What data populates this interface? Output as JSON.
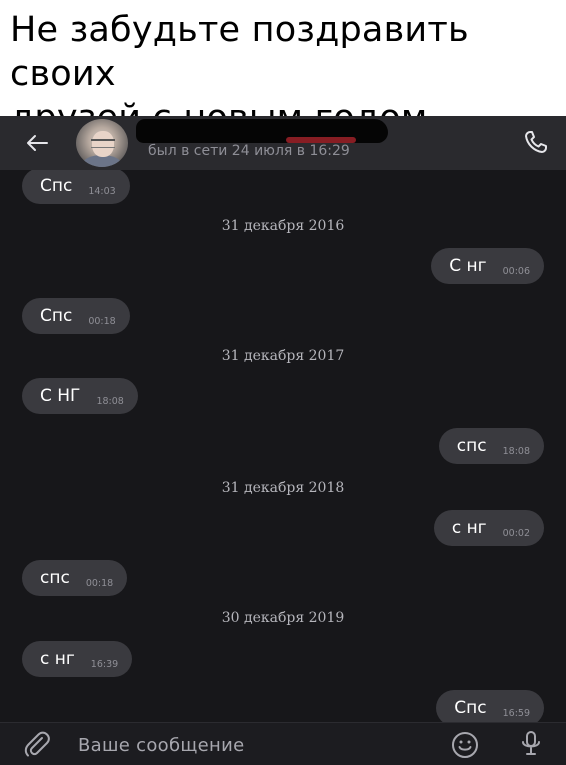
{
  "caption": {
    "line1": "Не забудьте поздравить своих",
    "line2": "друзей с новым годом"
  },
  "header": {
    "last_seen": "был в сети 24 июля в 16:29",
    "back_icon": "arrow-left-icon",
    "call_icon": "phone-icon"
  },
  "messages": [
    {
      "side": "in",
      "text": "Спс",
      "time": "14:03"
    },
    {
      "date": "31 декабря 2016"
    },
    {
      "side": "out",
      "text": "С нг",
      "time": "00:06"
    },
    {
      "side": "in",
      "text": "Спс",
      "time": "00:18"
    },
    {
      "date": "31 декабря 2017"
    },
    {
      "side": "in",
      "text": "С НГ",
      "time": "18:08"
    },
    {
      "side": "out",
      "text": "спс",
      "time": "18:08"
    },
    {
      "date": "31 декабря 2018"
    },
    {
      "side": "out",
      "text": "с нг",
      "time": "00:02"
    },
    {
      "side": "in",
      "text": "спс",
      "time": "00:18"
    },
    {
      "date": "30 декабря 2019"
    },
    {
      "side": "in",
      "text": "с нг",
      "time": "16:39"
    },
    {
      "side": "out",
      "text": "Спс",
      "time": "16:59"
    }
  ],
  "composer": {
    "placeholder": "Ваше сообщение",
    "attach_icon": "paperclip-icon",
    "emoji_icon": "smiley-icon",
    "mic_icon": "microphone-icon"
  },
  "colors": {
    "chat_bg": "#17171a",
    "header_bg": "#2a2a2e",
    "bubble_bg": "#3a3a3f",
    "text": "#ffffff",
    "muted": "#8f8f96"
  }
}
